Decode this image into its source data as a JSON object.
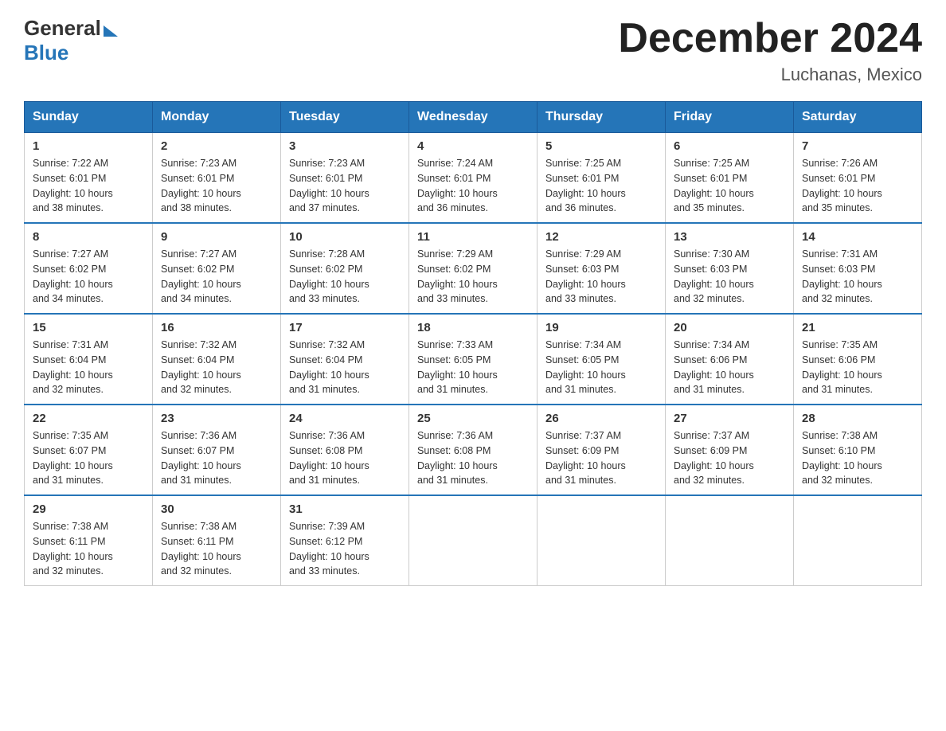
{
  "header": {
    "logo_general": "General",
    "logo_blue": "Blue",
    "month_title": "December 2024",
    "location": "Luchanas, Mexico"
  },
  "calendar": {
    "days_of_week": [
      "Sunday",
      "Monday",
      "Tuesday",
      "Wednesday",
      "Thursday",
      "Friday",
      "Saturday"
    ],
    "weeks": [
      [
        {
          "day": "1",
          "sunrise": "7:22 AM",
          "sunset": "6:01 PM",
          "daylight": "10 hours and 38 minutes."
        },
        {
          "day": "2",
          "sunrise": "7:23 AM",
          "sunset": "6:01 PM",
          "daylight": "10 hours and 38 minutes."
        },
        {
          "day": "3",
          "sunrise": "7:23 AM",
          "sunset": "6:01 PM",
          "daylight": "10 hours and 37 minutes."
        },
        {
          "day": "4",
          "sunrise": "7:24 AM",
          "sunset": "6:01 PM",
          "daylight": "10 hours and 36 minutes."
        },
        {
          "day": "5",
          "sunrise": "7:25 AM",
          "sunset": "6:01 PM",
          "daylight": "10 hours and 36 minutes."
        },
        {
          "day": "6",
          "sunrise": "7:25 AM",
          "sunset": "6:01 PM",
          "daylight": "10 hours and 35 minutes."
        },
        {
          "day": "7",
          "sunrise": "7:26 AM",
          "sunset": "6:01 PM",
          "daylight": "10 hours and 35 minutes."
        }
      ],
      [
        {
          "day": "8",
          "sunrise": "7:27 AM",
          "sunset": "6:02 PM",
          "daylight": "10 hours and 34 minutes."
        },
        {
          "day": "9",
          "sunrise": "7:27 AM",
          "sunset": "6:02 PM",
          "daylight": "10 hours and 34 minutes."
        },
        {
          "day": "10",
          "sunrise": "7:28 AM",
          "sunset": "6:02 PM",
          "daylight": "10 hours and 33 minutes."
        },
        {
          "day": "11",
          "sunrise": "7:29 AM",
          "sunset": "6:02 PM",
          "daylight": "10 hours and 33 minutes."
        },
        {
          "day": "12",
          "sunrise": "7:29 AM",
          "sunset": "6:03 PM",
          "daylight": "10 hours and 33 minutes."
        },
        {
          "day": "13",
          "sunrise": "7:30 AM",
          "sunset": "6:03 PM",
          "daylight": "10 hours and 32 minutes."
        },
        {
          "day": "14",
          "sunrise": "7:31 AM",
          "sunset": "6:03 PM",
          "daylight": "10 hours and 32 minutes."
        }
      ],
      [
        {
          "day": "15",
          "sunrise": "7:31 AM",
          "sunset": "6:04 PM",
          "daylight": "10 hours and 32 minutes."
        },
        {
          "day": "16",
          "sunrise": "7:32 AM",
          "sunset": "6:04 PM",
          "daylight": "10 hours and 32 minutes."
        },
        {
          "day": "17",
          "sunrise": "7:32 AM",
          "sunset": "6:04 PM",
          "daylight": "10 hours and 31 minutes."
        },
        {
          "day": "18",
          "sunrise": "7:33 AM",
          "sunset": "6:05 PM",
          "daylight": "10 hours and 31 minutes."
        },
        {
          "day": "19",
          "sunrise": "7:34 AM",
          "sunset": "6:05 PM",
          "daylight": "10 hours and 31 minutes."
        },
        {
          "day": "20",
          "sunrise": "7:34 AM",
          "sunset": "6:06 PM",
          "daylight": "10 hours and 31 minutes."
        },
        {
          "day": "21",
          "sunrise": "7:35 AM",
          "sunset": "6:06 PM",
          "daylight": "10 hours and 31 minutes."
        }
      ],
      [
        {
          "day": "22",
          "sunrise": "7:35 AM",
          "sunset": "6:07 PM",
          "daylight": "10 hours and 31 minutes."
        },
        {
          "day": "23",
          "sunrise": "7:36 AM",
          "sunset": "6:07 PM",
          "daylight": "10 hours and 31 minutes."
        },
        {
          "day": "24",
          "sunrise": "7:36 AM",
          "sunset": "6:08 PM",
          "daylight": "10 hours and 31 minutes."
        },
        {
          "day": "25",
          "sunrise": "7:36 AM",
          "sunset": "6:08 PM",
          "daylight": "10 hours and 31 minutes."
        },
        {
          "day": "26",
          "sunrise": "7:37 AM",
          "sunset": "6:09 PM",
          "daylight": "10 hours and 31 minutes."
        },
        {
          "day": "27",
          "sunrise": "7:37 AM",
          "sunset": "6:09 PM",
          "daylight": "10 hours and 32 minutes."
        },
        {
          "day": "28",
          "sunrise": "7:38 AM",
          "sunset": "6:10 PM",
          "daylight": "10 hours and 32 minutes."
        }
      ],
      [
        {
          "day": "29",
          "sunrise": "7:38 AM",
          "sunset": "6:11 PM",
          "daylight": "10 hours and 32 minutes."
        },
        {
          "day": "30",
          "sunrise": "7:38 AM",
          "sunset": "6:11 PM",
          "daylight": "10 hours and 32 minutes."
        },
        {
          "day": "31",
          "sunrise": "7:39 AM",
          "sunset": "6:12 PM",
          "daylight": "10 hours and 33 minutes."
        },
        null,
        null,
        null,
        null
      ]
    ],
    "labels": {
      "sunrise": "Sunrise:",
      "sunset": "Sunset:",
      "daylight": "Daylight:"
    }
  }
}
